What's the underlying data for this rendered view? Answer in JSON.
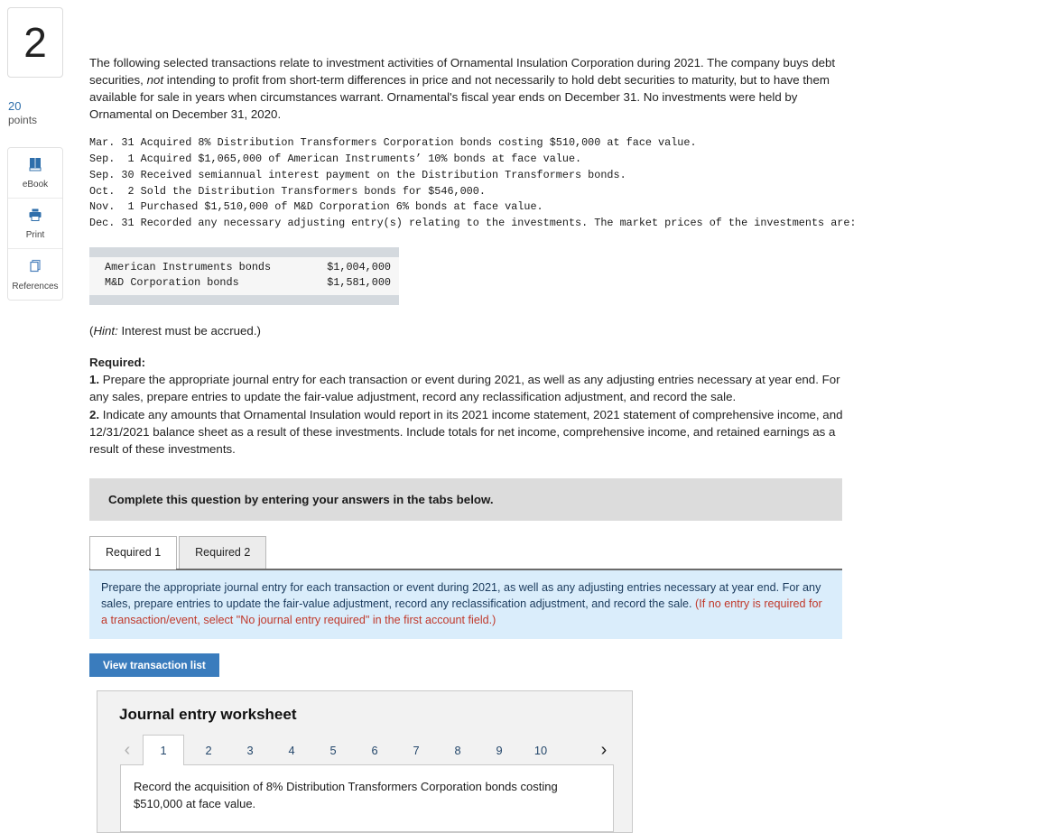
{
  "question": {
    "number": "2",
    "points_value": "20",
    "points_label": "points"
  },
  "tools": [
    {
      "label": "eBook",
      "icon": "ebook-icon"
    },
    {
      "label": "Print",
      "icon": "print-icon"
    },
    {
      "label": "References",
      "icon": "references-icon"
    }
  ],
  "intro": {
    "part1": "The following selected transactions relate to investment activities of Ornamental Insulation Corporation during 2021. The company buys debt securities, ",
    "emphasis": "not",
    "part2": " intending to profit from short-term differences in price and not necessarily to hold debt securities to maturity, but to have them available for sale in years when circumstances warrant. Ornamental's fiscal year ends on December 31. No investments were held by Ornamental on December 31, 2020."
  },
  "transactions": "Mar. 31 Acquired 8% Distribution Transformers Corporation bonds costing $510,000 at face value.\nSep.  1 Acquired $1,065,000 of American Instruments’ 10% bonds at face value.\nSep. 30 Received semiannual interest payment on the Distribution Transformers bonds.\nOct.  2 Sold the Distribution Transformers bonds for $546,000.\nNov.  1 Purchased $1,510,000 of M&D Corporation 6% bonds at face value.\nDec. 31 Recorded any necessary adjusting entry(s) relating to the investments. The market prices of the investments are:",
  "market_prices": {
    "rows": [
      {
        "name": "American Instruments bonds",
        "amount": "$1,004,000"
      },
      {
        "name": "M&D Corporation bonds",
        "amount": "$1,581,000"
      }
    ]
  },
  "hint": {
    "prefix": "(",
    "label": "Hint:",
    "text": " Interest must be accrued.)"
  },
  "required": {
    "heading": "Required:",
    "item1_num": "1.",
    "item1_text": " Prepare the appropriate journal entry for each transaction or event during 2021, as well as any adjusting entries necessary at year end. For any sales, prepare entries to update the fair-value adjustment, record any reclassification adjustment, and record the sale.",
    "item2_num": "2.",
    "item2_text": " Indicate any amounts that Ornamental Insulation would report in its 2021 income statement, 2021 statement of comprehensive income, and 12/31/2021 balance sheet as a result of these investments. Include totals for net income, comprehensive income, and retained earnings as a result of these investments."
  },
  "banner": {
    "text": "Complete this question by entering your answers in the tabs below."
  },
  "tabs": [
    {
      "label": "Required 1",
      "active": true
    },
    {
      "label": "Required 2",
      "active": false
    }
  ],
  "instruction_box": {
    "main_text": "Prepare the appropriate journal entry for each transaction or event during 2021, as well as any adjusting entries necessary at year end. For any sales, prepare entries to update the fair-value adjustment, record any reclassification adjustment, and record the sale. ",
    "note_text": "(If no entry is required for a transaction/event, select \"No journal entry required\" in the first account field.)"
  },
  "view_transaction_button": {
    "label": "View transaction list"
  },
  "worksheet": {
    "title": "Journal entry worksheet",
    "prev_arrow": "‹",
    "next_arrow": "›",
    "pages": [
      "1",
      "2",
      "3",
      "4",
      "5",
      "6",
      "7",
      "8",
      "9",
      "10"
    ],
    "active_page": "1",
    "description": "Record the acquisition of 8% Distribution Transformers Corporation bonds costing $510,000 at face value."
  },
  "colors": {
    "accent_blue": "#3a7cbd",
    "info_box_bg": "#daedfb",
    "banner_gray": "#dcdcdc",
    "points_blue": "#2f6fab",
    "note_red": "#c0392b"
  }
}
